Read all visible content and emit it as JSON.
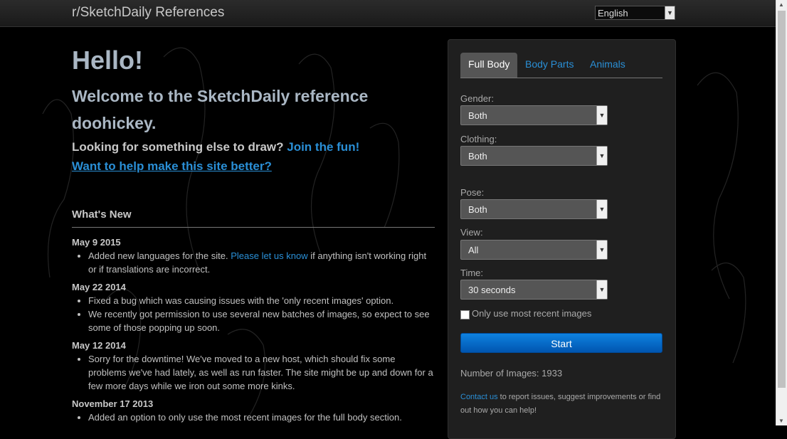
{
  "header": {
    "brand": "r/SketchDaily References",
    "language": "English"
  },
  "intro": {
    "hello": "Hello!",
    "welcome": "Welcome to the SketchDaily reference doohickey.",
    "looking_prefix": "Looking for something else to draw? ",
    "looking_link": "Join the fun!",
    "help_link": "Want to help make this site better?"
  },
  "whats_new": {
    "title": "What's New",
    "entries": [
      {
        "date": "May 9 2015",
        "items": [
          {
            "before": "Added new languages for the site. ",
            "link": "Please let us know",
            "after": " if anything isn't working right or if translations are incorrect."
          }
        ]
      },
      {
        "date": "May 22 2014",
        "items": [
          {
            "before": "Fixed a bug which was causing issues with the 'only recent images' option.",
            "link": "",
            "after": ""
          },
          {
            "before": "We recently got permission to use several new batches of images, so expect to see some of those popping up soon.",
            "link": "",
            "after": ""
          }
        ]
      },
      {
        "date": "May 12 2014",
        "items": [
          {
            "before": "Sorry for the downtime! We've moved to a new host, which should fix some problems we've had lately, as well as run faster. The site might be up and down for a few more days while we iron out some more kinks.",
            "link": "",
            "after": ""
          }
        ]
      },
      {
        "date": "November 17 2013",
        "items": [
          {
            "before": "Added an option to only use the most recent images for the full body section.",
            "link": "",
            "after": ""
          }
        ]
      }
    ]
  },
  "panel": {
    "tabs": [
      "Full Body",
      "Body Parts",
      "Animals"
    ],
    "active_tab": "Full Body",
    "fields": {
      "gender": {
        "label": "Gender:",
        "value": "Both"
      },
      "clothing": {
        "label": "Clothing:",
        "value": "Both"
      },
      "pose": {
        "label": "Pose:",
        "value": "Both"
      },
      "view": {
        "label": "View:",
        "value": "All"
      },
      "time": {
        "label": "Time:",
        "value": "30 seconds"
      }
    },
    "recent_only_label": "Only use most recent images",
    "recent_only_checked": false,
    "start_label": "Start",
    "num_images": "Number of Images: 1933",
    "contact_link": "Contact us",
    "contact_text": " to report issues, suggest improvements or find out how you can help!"
  },
  "colors": {
    "link": "#2a8fd6",
    "heading": "#aab7c4",
    "start_button": "#0a6fd0",
    "panel_bg": "#1f1f1f"
  }
}
